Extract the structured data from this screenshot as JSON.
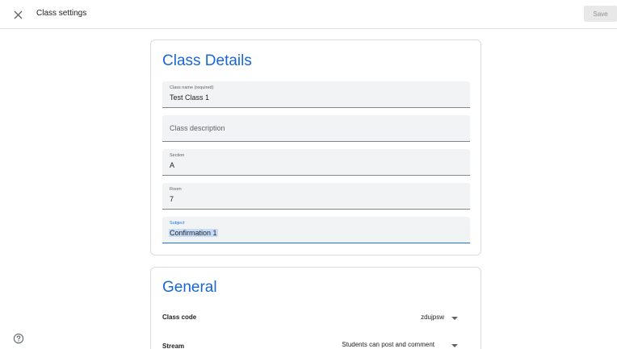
{
  "header": {
    "title": "Class settings",
    "save_label": "Save"
  },
  "class_details": {
    "heading": "Class Details",
    "fields": [
      {
        "label": "Class name (required)",
        "value": "Test Class 1"
      },
      {
        "label": "",
        "placeholder": "Class description",
        "value": ""
      },
      {
        "label": "Section",
        "value": "A"
      },
      {
        "label": "Room",
        "value": "7"
      },
      {
        "label": "Subject",
        "value": "Confirmation 1"
      }
    ]
  },
  "general": {
    "heading": "General",
    "class_code": {
      "label": "Class code",
      "value": "zdujpsw"
    },
    "stream": {
      "label": "Stream",
      "value": "Students can post and comment"
    }
  },
  "colors": {
    "accent": "#1967d2",
    "field_bg": "#f1f3f4",
    "focus_underline": "#1a73e8",
    "selection": "#c7dcf7"
  },
  "icons": {
    "close": "close-icon",
    "dropdown": "arrow-drop-down-icon",
    "help": "help-outline-icon"
  }
}
